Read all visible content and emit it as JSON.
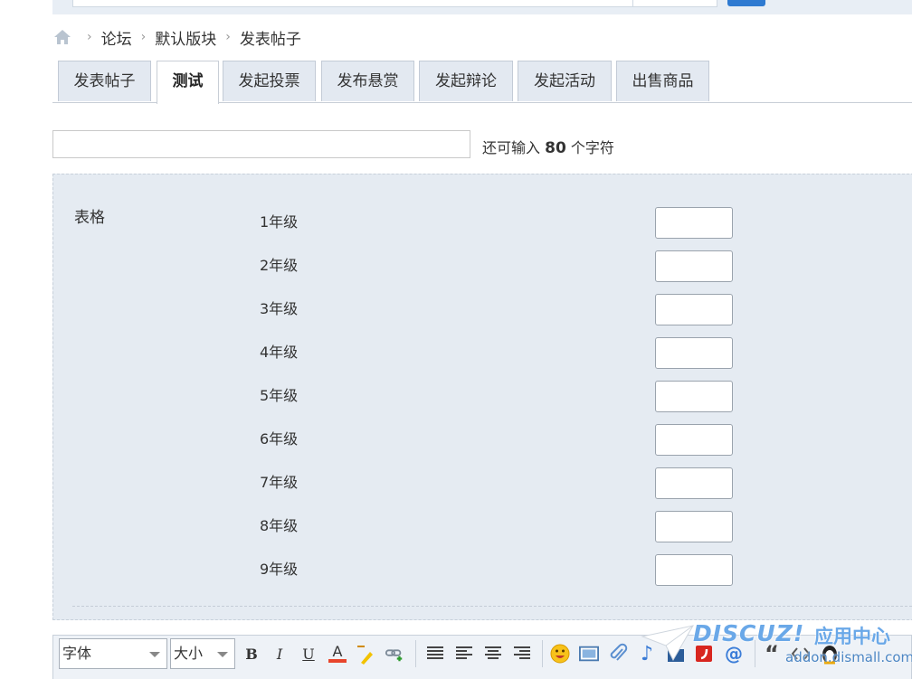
{
  "breadcrumb": {
    "items": [
      "论坛",
      "默认版块",
      "发表帖子"
    ],
    "separator": "›"
  },
  "tabs": [
    {
      "label": "发表帖子",
      "active": false
    },
    {
      "label": "测试",
      "active": true
    },
    {
      "label": "发起投票",
      "active": false
    },
    {
      "label": "发布悬赏",
      "active": false
    },
    {
      "label": "发起辩论",
      "active": false
    },
    {
      "label": "发起活动",
      "active": false
    },
    {
      "label": "出售商品",
      "active": false
    }
  ],
  "subject": {
    "value": "",
    "hint_prefix": "还可输入",
    "hint_count": "80",
    "hint_suffix": "个字符"
  },
  "table": {
    "label": "表格",
    "rows": [
      {
        "label": "1年级",
        "value": ""
      },
      {
        "label": "2年级",
        "value": ""
      },
      {
        "label": "3年级",
        "value": ""
      },
      {
        "label": "4年级",
        "value": ""
      },
      {
        "label": "5年级",
        "value": ""
      },
      {
        "label": "6年级",
        "value": ""
      },
      {
        "label": "7年级",
        "value": ""
      },
      {
        "label": "8年级",
        "value": ""
      },
      {
        "label": "9年级",
        "value": ""
      }
    ]
  },
  "editor": {
    "font_select": "字体",
    "size_select": "大小",
    "bold": "B",
    "italic": "I",
    "underline": "U",
    "font_color": "A",
    "quote": "“"
  },
  "watermark": {
    "brand": "DISCUZ!",
    "center": "应用中心",
    "email": "addon.dismall.com"
  },
  "colors": {
    "accent": "#2e7ad1",
    "panel_bg": "#e5ebf2",
    "tab_bg": "#e3e9f1"
  }
}
